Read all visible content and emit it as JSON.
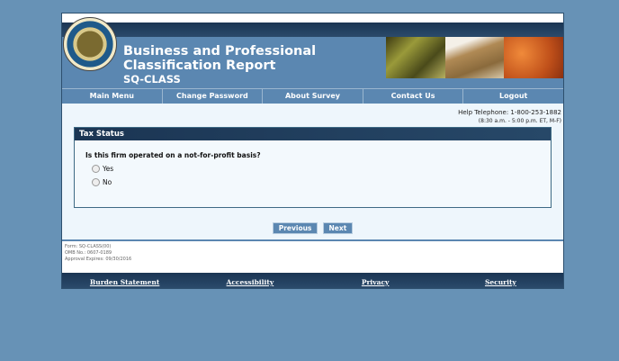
{
  "header": {
    "title_line1": "Business and Professional",
    "title_line2": "Classification Report",
    "subtitle": "SQ-CLASS",
    "seal_text": "U.S. DEPARTMENT OF COMMERCE - BUREAU OF THE CENSUS"
  },
  "nav": [
    {
      "label": "Main Menu"
    },
    {
      "label": "Change Password"
    },
    {
      "label": "About Survey"
    },
    {
      "label": "Contact Us"
    },
    {
      "label": "Logout"
    }
  ],
  "help": {
    "telephone": "Help Telephone: 1-800-253-1882",
    "hours": "(8:30 a.m. - 5:00 p.m. ET, M-F)"
  },
  "panel": {
    "title": "Tax Status",
    "question": "Is this firm operated on a not-for-profit basis?",
    "options": [
      {
        "label": "Yes",
        "selected": false
      },
      {
        "label": "No",
        "selected": false
      }
    ]
  },
  "buttons": {
    "previous": "Previous",
    "next": "Next"
  },
  "form_info": {
    "form": "Form: SQ-CLASS(00)",
    "omb": "OMB No.: 0607-0189",
    "expires": "Approval Expires: 09/30/2016"
  },
  "footer": [
    {
      "label": "Burden Statement"
    },
    {
      "label": "Accessibility"
    },
    {
      "label": "Privacy"
    },
    {
      "label": "Security"
    }
  ]
}
